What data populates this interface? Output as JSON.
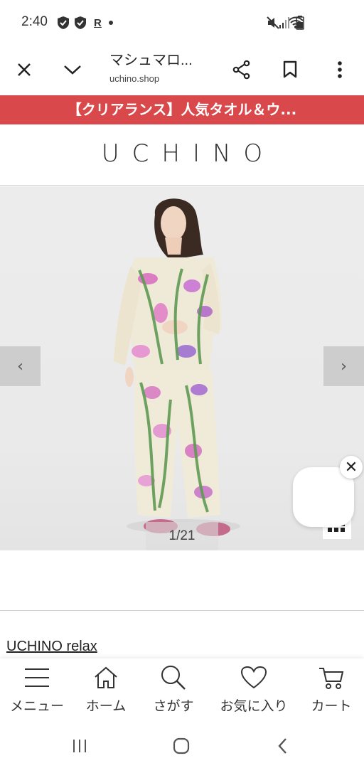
{
  "status": {
    "time": "2:40",
    "r_label": "R"
  },
  "browser": {
    "title": "マシュマロ...",
    "url": "uchino.shop"
  },
  "banner": {
    "text": "【クリアランス】人気タオル＆ウ..."
  },
  "logo": {
    "text": "UCHINO"
  },
  "carousel": {
    "counter": "1/21",
    "prev": "‹",
    "next": "›"
  },
  "chat": {
    "close": "✕"
  },
  "brand": {
    "link": "UCHINO relax"
  },
  "bottom_nav": {
    "items": [
      {
        "label": "メニュー",
        "icon": "menu-icon"
      },
      {
        "label": "ホーム",
        "icon": "home-icon"
      },
      {
        "label": "さがす",
        "icon": "search-icon"
      },
      {
        "label": "お気に入り",
        "icon": "heart-icon"
      },
      {
        "label": "カート",
        "icon": "cart-icon"
      }
    ]
  },
  "colors": {
    "banner": "#d9484a",
    "text": "#222222"
  }
}
